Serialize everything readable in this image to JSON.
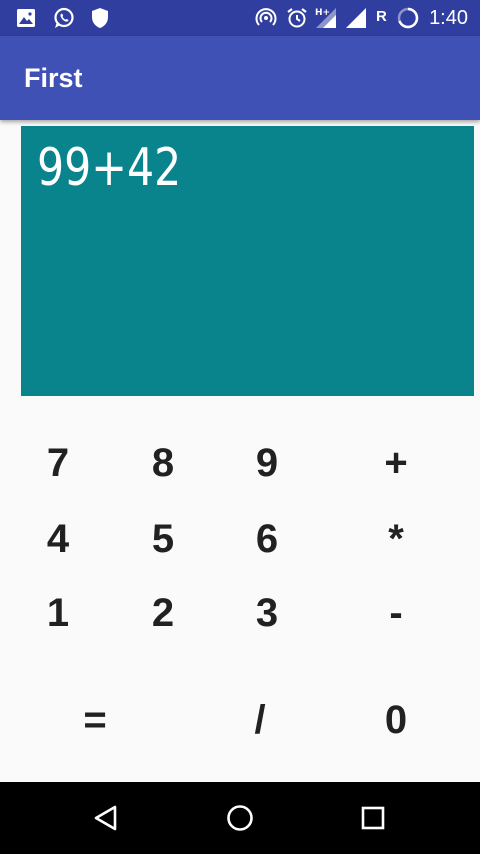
{
  "status_bar": {
    "time": "1:40",
    "network_letter": "R",
    "icons_left": [
      "image-icon",
      "whatsapp-icon",
      "shield-icon"
    ],
    "icons_right": [
      "hotspot-icon",
      "alarm-icon",
      "hplus-signal-icon",
      "signal-icon",
      "battery-charging-icon"
    ]
  },
  "app_bar": {
    "title": "First"
  },
  "display": {
    "expression": "99+42"
  },
  "keypad": {
    "row1": [
      "7",
      "8",
      "9",
      "+"
    ],
    "row2": [
      "4",
      "5",
      "6",
      "*"
    ],
    "row3": [
      "1",
      "2",
      "3",
      "-"
    ],
    "row4": [
      "=",
      "/",
      "0"
    ]
  },
  "nav_bar": {
    "buttons": [
      "back-icon",
      "home-icon",
      "recents-icon"
    ]
  },
  "colors": {
    "status_bar": "#303f9f",
    "app_bar": "#3f51b5",
    "display_bg": "#0a848c",
    "display_text": "#ffffff",
    "key_text": "#212121",
    "background": "#fafafa"
  }
}
